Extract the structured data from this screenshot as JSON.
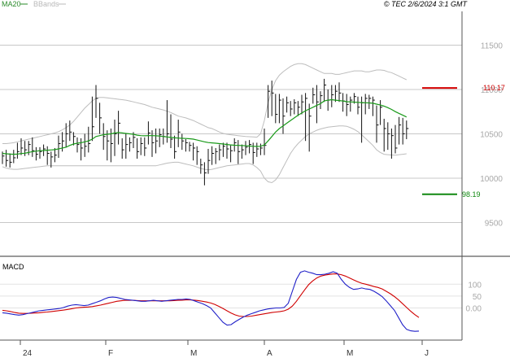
{
  "header": {
    "indicators": [
      {
        "label": "MA20",
        "color": "#2a8a2a"
      },
      {
        "label": "BBands",
        "color": "#b8b8b8"
      }
    ],
    "stamp": "© TEC 2/6/2024 3:1 GMT"
  },
  "colors": {
    "price_bar": "#111111",
    "ma20": "#1a9a1a",
    "bbands": "#bdbdbd",
    "resistance": "#d40000",
    "support": "#118811",
    "macd": "#2020c8",
    "signal": "#d00000",
    "grid": "#c8c8c8",
    "frame": "#555555",
    "axis_text": "#a8a8a8"
  },
  "chart_data": [
    {
      "type": "ohlc",
      "title": "",
      "y_ticks": [
        {
          "value": 9500,
          "label": "9500"
        },
        {
          "value": 10000,
          "label": "10000"
        },
        {
          "value": 10500,
          "label": "10500"
        },
        {
          "value": 11000,
          "label": "11000"
        },
        {
          "value": 11500,
          "label": "11500"
        }
      ],
      "ylim": [
        9120,
        11880
      ],
      "x_ticks": [
        "24",
        "F",
        "M",
        "A",
        "M",
        "J"
      ],
      "resistance": {
        "value": 11017,
        "label": "110.17"
      },
      "support": {
        "value": 9819,
        "label": "98.19"
      },
      "series": {
        "close": [
          10250,
          10200,
          10180,
          10230,
          10300,
          10340,
          10320,
          10380,
          10310,
          10270,
          10300,
          10330,
          10280,
          10240,
          10260,
          10390,
          10420,
          10500,
          10520,
          10470,
          10380,
          10340,
          10360,
          10390,
          10580,
          10900,
          10680,
          10470,
          10420,
          10390,
          10500,
          10620,
          10320,
          10380,
          10400,
          10460,
          10300,
          10390,
          10340,
          10510,
          10400,
          10420,
          10490,
          10470,
          10500,
          10440,
          10300,
          10520,
          10420,
          10400,
          10370,
          10340,
          10300,
          10150,
          10060,
          10200,
          10280,
          10300,
          10320,
          10360,
          10330,
          10310,
          10400,
          10300,
          10320,
          10350,
          10380,
          10290,
          10330,
          10340,
          10370,
          10980,
          10960,
          10720,
          10880,
          10700,
          10850,
          10780,
          10850,
          10800,
          10860,
          10900,
          10700,
          10940,
          10860,
          10930,
          11050,
          10880,
          10940,
          10980,
          10960,
          10870,
          10830,
          10880,
          10920,
          10800,
          10850,
          10900,
          10900,
          10880,
          10600,
          10800,
          10560,
          10500,
          10480,
          10340,
          10600,
          10500,
          10560
        ],
        "high": [
          10300,
          10320,
          10280,
          10320,
          10400,
          10450,
          10420,
          10420,
          10460,
          10350,
          10350,
          10380,
          10360,
          10300,
          10340,
          10480,
          10520,
          10620,
          10650,
          10520,
          10460,
          10450,
          10500,
          10580,
          10920,
          11050,
          10850,
          10620,
          10540,
          10560,
          10660,
          10760,
          10450,
          10500,
          10460,
          10520,
          10450,
          10460,
          10460,
          10640,
          10540,
          10560,
          10560,
          10560,
          10880,
          10720,
          10480,
          10660,
          10500,
          10440,
          10410,
          10400,
          10360,
          10220,
          10180,
          10330,
          10360,
          10340,
          10380,
          10400,
          10400,
          10370,
          10450,
          10430,
          10380,
          10420,
          10430,
          10400,
          10400,
          10390,
          10560,
          11050,
          11100,
          10950,
          10950,
          10900,
          10920,
          10870,
          10890,
          10870,
          10940,
          10960,
          10840,
          11020,
          11050,
          10980,
          11120,
          11000,
          11050,
          11050,
          11080,
          10960,
          10950,
          10920,
          10960,
          10920,
          10920,
          10950,
          10940,
          10920,
          10820,
          10880,
          10670,
          10630,
          10560,
          10600,
          10690,
          10680,
          10650
        ],
        "low": [
          10160,
          10130,
          10120,
          10170,
          10220,
          10260,
          10250,
          10260,
          10240,
          10200,
          10220,
          10250,
          10150,
          10120,
          10180,
          10230,
          10300,
          10350,
          10420,
          10370,
          10290,
          10200,
          10240,
          10290,
          10420,
          10680,
          10500,
          10320,
          10200,
          10180,
          10250,
          10380,
          10220,
          10220,
          10300,
          10340,
          10220,
          10260,
          10250,
          10380,
          10240,
          10280,
          10350,
          10380,
          10400,
          10340,
          10220,
          10350,
          10320,
          10300,
          10300,
          10200,
          10150,
          10050,
          9920,
          10050,
          10150,
          10160,
          10200,
          10240,
          10220,
          10180,
          10300,
          10160,
          10220,
          10260,
          10280,
          10160,
          10240,
          10260,
          10260,
          10680,
          10700,
          10620,
          10620,
          10500,
          10740,
          10700,
          10720,
          10700,
          10720,
          10420,
          10300,
          10840,
          10620,
          10780,
          10860,
          10760,
          10800,
          10860,
          10860,
          10750,
          10700,
          10750,
          10840,
          10720,
          10400,
          10720,
          10780,
          10700,
          10400,
          10600,
          10300,
          10320,
          10220,
          10280,
          10380,
          10380,
          10440
        ],
        "ma20": [
          10280,
          10275,
          10272,
          10270,
          10272,
          10278,
          10282,
          10290,
          10300,
          10305,
          10310,
          10312,
          10316,
          10318,
          10322,
          10330,
          10340,
          10350,
          10370,
          10385,
          10395,
          10400,
          10410,
          10420,
          10440,
          10470,
          10480,
          10490,
          10495,
          10500,
          10510,
          10515,
          10510,
          10505,
          10500,
          10495,
          10485,
          10480,
          10478,
          10480,
          10480,
          10478,
          10475,
          10470,
          10465,
          10460,
          10455,
          10452,
          10450,
          10448,
          10445,
          10440,
          10430,
          10420,
          10410,
          10402,
          10398,
          10395,
          10390,
          10385,
          10380,
          10375,
          10372,
          10370,
          10368,
          10365,
          10362,
          10360,
          10358,
          10360,
          10375,
          10420,
          10470,
          10520,
          10560,
          10590,
          10620,
          10650,
          10680,
          10710,
          10735,
          10760,
          10780,
          10800,
          10820,
          10840,
          10870,
          10880,
          10885,
          10880,
          10875,
          10870,
          10862,
          10860,
          10858,
          10855,
          10852,
          10850,
          10848,
          10845,
          10835,
          10825,
          10812,
          10795,
          10775,
          10750,
          10730,
          10710,
          10690
        ],
        "bb_upper": [
          10390,
          10390,
          10395,
          10400,
          10410,
          10420,
          10430,
          10440,
          10450,
          10460,
          10470,
          10480,
          10490,
          10500,
          10510,
          10525,
          10545,
          10570,
          10600,
          10640,
          10690,
          10740,
          10790,
          10830,
          10870,
          10900,
          10910,
          10910,
          10905,
          10900,
          10895,
          10890,
          10885,
          10880,
          10870,
          10860,
          10850,
          10840,
          10830,
          10815,
          10800,
          10790,
          10780,
          10770,
          10755,
          10740,
          10720,
          10700,
          10690,
          10680,
          10665,
          10650,
          10630,
          10610,
          10590,
          10570,
          10560,
          10540,
          10520,
          10505,
          10495,
          10490,
          10485,
          10480,
          10475,
          10470,
          10468,
          10465,
          10462,
          10500,
          10650,
          10850,
          11000,
          11100,
          11160,
          11200,
          11230,
          11260,
          11280,
          11290,
          11290,
          11280,
          11260,
          11240,
          11220,
          11200,
          11180,
          11180,
          11180,
          11170,
          11170,
          11180,
          11190,
          11200,
          11210,
          11210,
          11210,
          11200,
          11200,
          11210,
          11220,
          11220,
          11215,
          11200,
          11190,
          11170,
          11150,
          11130,
          11110
        ],
        "bb_lower": [
          10130,
          10115,
          10105,
          10100,
          10100,
          10105,
          10110,
          10115,
          10120,
          10125,
          10130,
          10135,
          10140,
          10140,
          10140,
          10140,
          10140,
          10140,
          10140,
          10140,
          10140,
          10140,
          10140,
          10140,
          10140,
          10140,
          10140,
          10140,
          10140,
          10140,
          10140,
          10140,
          10140,
          10140,
          10140,
          10140,
          10140,
          10140,
          10140,
          10140,
          10140,
          10140,
          10150,
          10160,
          10170,
          10175,
          10180,
          10180,
          10170,
          10160,
          10150,
          10140,
          10125,
          10110,
          10100,
          10095,
          10100,
          10110,
          10120,
          10130,
          10140,
          10145,
          10150,
          10155,
          10160,
          10165,
          10165,
          10150,
          10120,
          10080,
          10000,
          9960,
          9950,
          9980,
          10040,
          10120,
          10200,
          10280,
          10340,
          10390,
          10430,
          10470,
          10500,
          10520,
          10540,
          10555,
          10565,
          10575,
          10580,
          10585,
          10590,
          10590,
          10585,
          10570,
          10550,
          10525,
          10490,
          10450,
          10410,
          10370,
          10320,
          10290,
          10270,
          10265,
          10262,
          10260,
          10265,
          10270,
          10275
        ]
      }
    },
    {
      "type": "line",
      "title": "MACD",
      "y_ticks": [
        {
          "value": 0,
          "label": "0.00"
        },
        {
          "value": 50,
          "label": "50"
        },
        {
          "value": 100,
          "label": "100"
        }
      ],
      "ylim": [
        -135,
        200
      ],
      "series": [
        {
          "name": "",
          "values": [
            -20,
            -22,
            -25,
            -28,
            -30,
            -28,
            -24,
            -20,
            -16,
            -12,
            -10,
            -8,
            -6,
            -4,
            -2,
            2,
            8,
            12,
            14,
            12,
            10,
            12,
            18,
            24,
            30,
            38,
            44,
            46,
            44,
            40,
            36,
            34,
            32,
            30,
            28,
            28,
            30,
            32,
            30,
            28,
            30,
            32,
            34,
            36,
            36,
            38,
            36,
            30,
            24,
            18,
            10,
            0,
            -20,
            -40,
            -60,
            -72,
            -70,
            -58,
            -48,
            -38,
            -30,
            -24,
            -18,
            -12,
            -8,
            -4,
            -2,
            0,
            0,
            2,
            20,
            70,
            120,
            150,
            156,
            150,
            146,
            140,
            140,
            142,
            146,
            152,
            146,
            120,
            100,
            86,
            78,
            80,
            84,
            80,
            78,
            70,
            60,
            48,
            30,
            10,
            -10,
            -40,
            -70,
            -90,
            -96,
            -98,
            -97
          ]
        },
        {
          "name": "",
          "values": [
            -10,
            -12,
            -15,
            -19,
            -22,
            -23,
            -23,
            -22,
            -21,
            -20,
            -18,
            -17,
            -15,
            -13,
            -11,
            -9,
            -6,
            -3,
            0,
            2,
            3,
            4,
            6,
            9,
            12,
            16,
            20,
            24,
            28,
            30,
            32,
            32,
            32,
            31,
            30,
            30,
            30,
            30,
            30,
            30,
            30,
            30,
            31,
            32,
            33,
            34,
            34,
            33,
            31,
            28,
            25,
            21,
            15,
            7,
            -2,
            -12,
            -21,
            -29,
            -34,
            -36,
            -36,
            -34,
            -31,
            -28,
            -25,
            -22,
            -19,
            -17,
            -15,
            -12,
            -5,
            8,
            28,
            52,
            76,
            98,
            114,
            126,
            134,
            138,
            141,
            143,
            143,
            140,
            134,
            126,
            118,
            110,
            104,
            100,
            95,
            90,
            86,
            80,
            70,
            60,
            48,
            34,
            18,
            2,
            -14,
            -28,
            -40
          ]
        }
      ]
    }
  ],
  "macd_label": "MACD"
}
